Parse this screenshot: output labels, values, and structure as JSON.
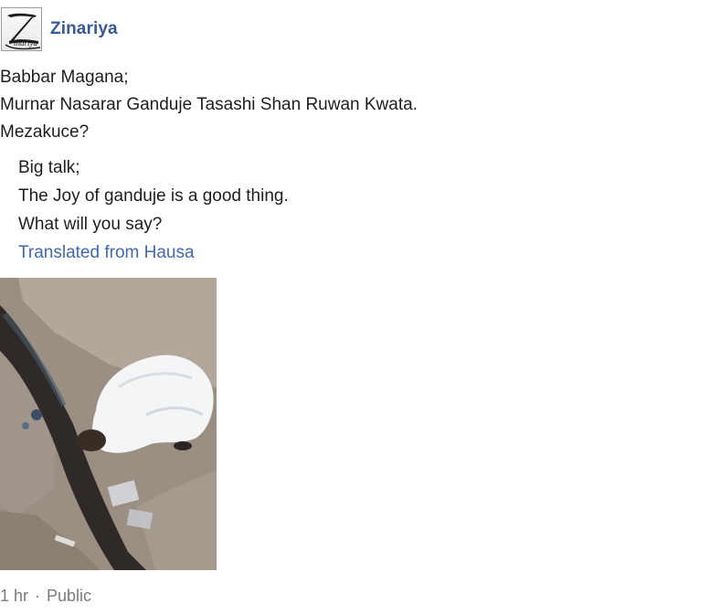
{
  "post": {
    "author": {
      "name": "Zinariya",
      "avatar_letter": "Z",
      "avatar_text": "inariya"
    },
    "lines": [
      "Babbar Magana;",
      "Murnar Nasarar Ganduje Tasashi Shan Ruwan Kwata.",
      "Mezakuce?"
    ],
    "translation": {
      "lines": [
        "Big talk;",
        "The Joy of ganduje is a good thing.",
        "What will you say?"
      ],
      "link_label": "Translated from Hausa"
    },
    "photo": {
      "alt": "Man in white robe bending over a drainage gutter"
    },
    "meta": {
      "time": "1 hr",
      "separator": "·",
      "privacy": "Public"
    }
  }
}
